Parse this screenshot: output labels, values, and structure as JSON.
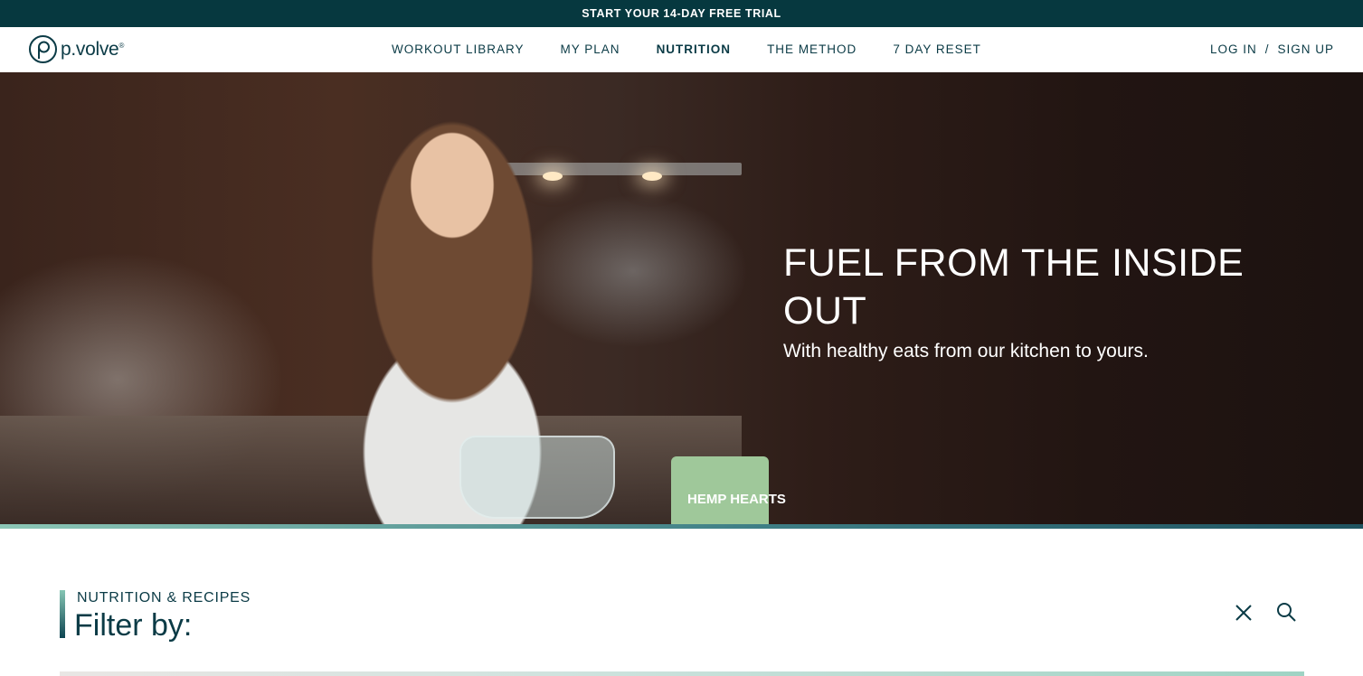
{
  "promo": {
    "text": "START YOUR 14-DAY FREE TRIAL"
  },
  "brand": {
    "name": "p.volve",
    "mark": "®"
  },
  "nav": {
    "items": [
      {
        "label": "WORKOUT LIBRARY",
        "active": false
      },
      {
        "label": "MY PLAN",
        "active": false
      },
      {
        "label": "NUTRITION",
        "active": true
      },
      {
        "label": "THE METHOD",
        "active": false
      },
      {
        "label": "7 DAY RESET",
        "active": false
      }
    ],
    "login": "LOG IN",
    "separator": "/",
    "signup": "SIGN UP"
  },
  "hero": {
    "title": "FUEL FROM THE INSIDE OUT",
    "subtitle": "With healthy eats from our kitchen to yours.",
    "bag_text": "HEMP HEARTS"
  },
  "filter": {
    "eyebrow": "NUTRITION & RECIPES",
    "title": "Filter by:"
  },
  "icons": {
    "close": "close-icon",
    "search": "search-icon"
  },
  "colors": {
    "promo_bg": "#06383f",
    "brand_text": "#0b3b46",
    "accent": "#86c6b4"
  }
}
